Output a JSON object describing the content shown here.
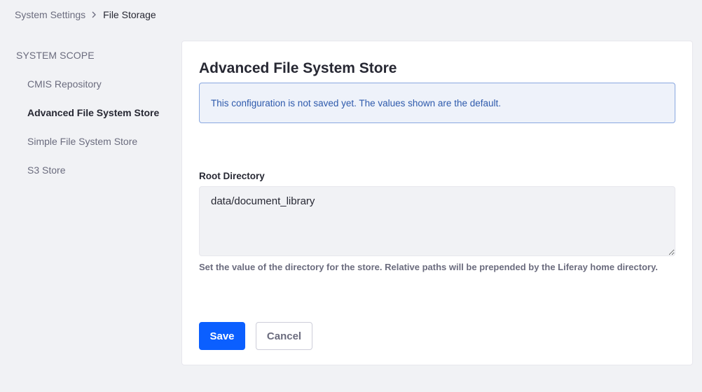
{
  "breadcrumb": {
    "parent": "System Settings",
    "separator_icon": "chevron-right-icon",
    "current": "File Storage"
  },
  "sidebar": {
    "header": "SYSTEM SCOPE",
    "items": [
      {
        "label": "CMIS Repository",
        "active": false
      },
      {
        "label": "Advanced File System Store",
        "active": true
      },
      {
        "label": "Simple File System Store",
        "active": false
      },
      {
        "label": "S3 Store",
        "active": false
      }
    ]
  },
  "card": {
    "title": "Advanced File System Store",
    "alert": "This configuration is not saved yet. The values shown are the default.",
    "field": {
      "label": "Root Directory",
      "value": "data/document_library",
      "help": "Set the value of the directory for the store. Relative paths will be prepended by the Liferay home directory."
    },
    "buttons": {
      "save": "Save",
      "cancel": "Cancel"
    }
  },
  "colors": {
    "primary": "#0b5fff",
    "alert_background": "#eef2fa",
    "alert_border": "#89a7e0",
    "alert_text": "#2e5aac",
    "page_background": "#f1f2f5"
  }
}
